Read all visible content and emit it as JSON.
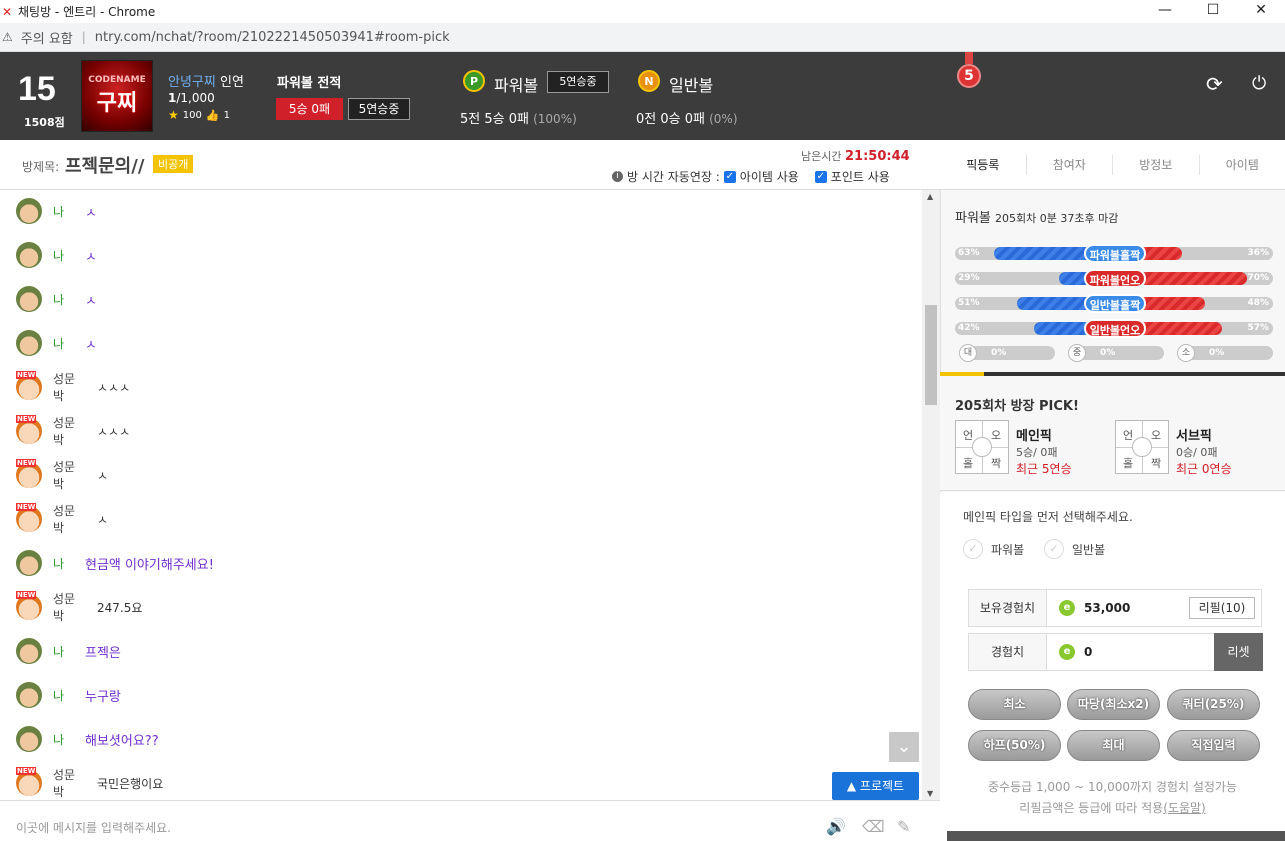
{
  "window": {
    "title": "채팅방 - 엔트리 - Chrome",
    "min": "—",
    "max": "☐",
    "close": "✕"
  },
  "address": {
    "warning": "⚠",
    "security": "주의 요함",
    "url": "ntry.com/nchat/?room/2102221450503941#room-pick"
  },
  "user": {
    "level": "15",
    "points": "1508점",
    "avatar_top": "CODENAME",
    "avatar_main": "구찌",
    "greeting_name": "안녕구찌",
    "greeting_suffix": "인연",
    "money_current": "1",
    "money_total": "/1,000",
    "stars": "100",
    "likes": "1"
  },
  "powerball_record": {
    "title": "파워볼 전적",
    "wins": "5승 0패",
    "streak": "5연승중"
  },
  "powerball": {
    "coin": "P",
    "title": "파워볼",
    "streak": "5연승중",
    "record_main": "5전 5승 0패",
    "record_pct": "(100%)"
  },
  "normalball": {
    "coin": "N",
    "title": "일반볼",
    "record_main": "0전 0승 0패",
    "record_pct": "(0%)"
  },
  "medal": {
    "rank": "5"
  },
  "icons": {
    "refresh": "⟳",
    "power": "⏻"
  },
  "room": {
    "label": "방제목:",
    "name": "프젝문의//",
    "privacy": "비공개",
    "remain_label": "남은시간",
    "remain_time": "21:50:44",
    "info": "i",
    "auto_extend": "방 시간 자동연장 :",
    "item_use": "아이템 사용",
    "point_use": "포인트 사용"
  },
  "tabs": [
    "픽등록",
    "참여자",
    "방정보",
    "아이템"
  ],
  "chat": {
    "messages": [
      {
        "who": "me",
        "nick": "나",
        "text": "ㅅ"
      },
      {
        "who": "me",
        "nick": "나",
        "text": "ㅅ"
      },
      {
        "who": "me",
        "nick": "나",
        "text": "ㅅ"
      },
      {
        "who": "me",
        "nick": "나",
        "text": "ㅅ"
      },
      {
        "who": "ot",
        "nick": "성문박",
        "text": "ㅅㅅㅅ"
      },
      {
        "who": "ot",
        "nick": "성문박",
        "text": "ㅅㅅㅅ"
      },
      {
        "who": "ot",
        "nick": "성문박",
        "text": "ㅅ"
      },
      {
        "who": "ot",
        "nick": "성문박",
        "text": "ㅅ"
      },
      {
        "who": "me",
        "nick": "나",
        "text": "현금액 이야기해주세요!"
      },
      {
        "who": "ot",
        "nick": "성문박",
        "text": "247.5요"
      },
      {
        "who": "me",
        "nick": "나",
        "text": "프젝은"
      },
      {
        "who": "me",
        "nick": "나",
        "text": "누구랑"
      },
      {
        "who": "me",
        "nick": "나",
        "text": "해보셧어요??"
      },
      {
        "who": "ot",
        "nick": "성문박",
        "text": "국민은행이요"
      }
    ],
    "new_badge": "NEW",
    "down": "⌄",
    "project_btn": "▲ 프로젝트",
    "placeholder": "이곳에 메시지를 입력해주세요.",
    "icon_sound": "🔊",
    "icon_eraser": "⌫",
    "icon_magic": "✎"
  },
  "round": {
    "title": "파워볼",
    "info": "205회차 0분 37초후 마감"
  },
  "bars": [
    {
      "label": "파워볼홀짝",
      "left": "63%",
      "right": "36%",
      "l": 63,
      "r": 36,
      "color": "blue"
    },
    {
      "label": "파워볼언오",
      "left": "29%",
      "right": "70%",
      "l": 29,
      "r": 70,
      "color": "red"
    },
    {
      "label": "일반볼홀짝",
      "left": "51%",
      "right": "48%",
      "l": 51,
      "r": 48,
      "color": "blue"
    },
    {
      "label": "일반볼언오",
      "left": "42%",
      "right": "57%",
      "l": 42,
      "r": 57,
      "color": "red"
    }
  ],
  "size_bars": [
    {
      "ico": "대",
      "pct": "0%"
    },
    {
      "ico": "중",
      "pct": "0%"
    },
    {
      "ico": "소",
      "pct": "0%"
    }
  ],
  "pick": {
    "title": "205회차 방장 PICK!",
    "main": {
      "name": "메인픽",
      "record": "5승/ 0패",
      "streak": "최근 5연승"
    },
    "sub": {
      "name": "서브픽",
      "record": "0승/ 0패",
      "streak": "최근 0연승"
    },
    "cells": {
      "tl": "언",
      "tr": "오",
      "bl": "홀",
      "br": "짝"
    }
  },
  "bet": {
    "hint": "메인픽 타입을 먼저 선택해주세요.",
    "opt1": "파워볼",
    "opt2": "일반볼",
    "check": "✓",
    "exp_label": "보유경험치",
    "exp_value": "53,000",
    "refill": "리필(10)",
    "amt_label": "경험치",
    "amt_value": "0",
    "reset": "리셋",
    "e": "e",
    "chips": [
      "최소",
      "따당(최소x2)",
      "쿼터(25%)",
      "하프(50%)",
      "최대",
      "직접입력"
    ],
    "note1": "중수등급 1,000 ~ 10,000까지 경험치 설정가능",
    "note2": "리필금액은 등급에 따라 적용",
    "help": "(도움말)"
  }
}
